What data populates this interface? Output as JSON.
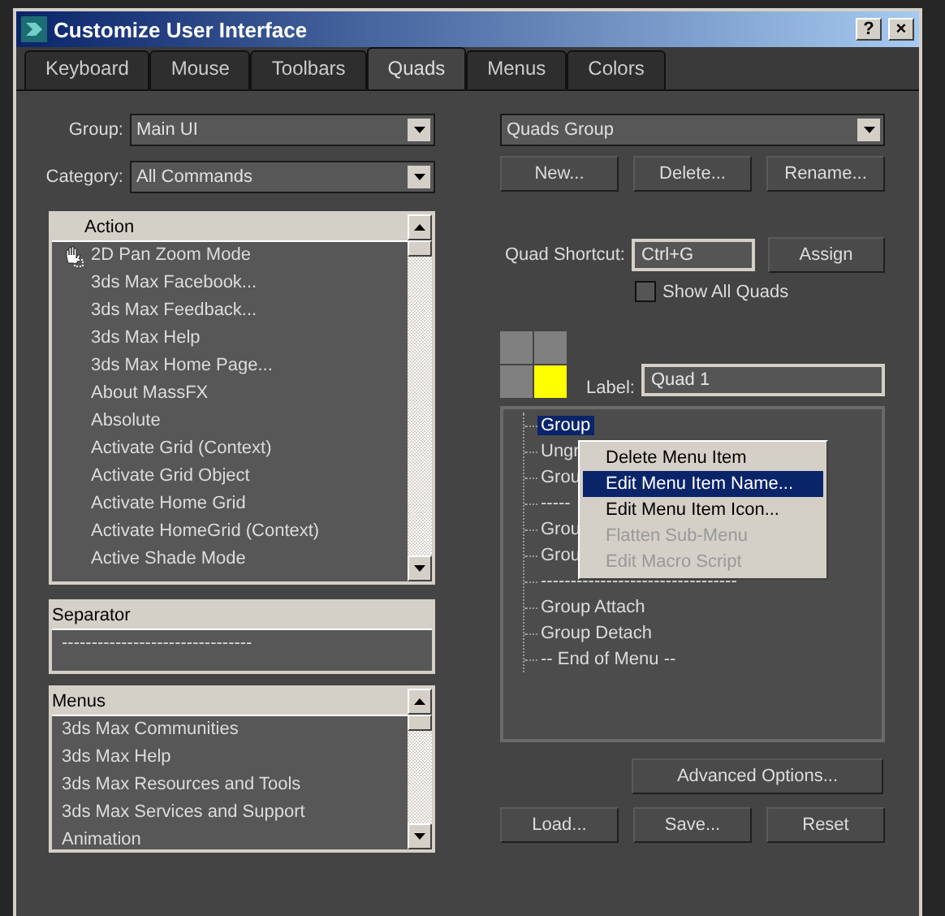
{
  "window": {
    "title": "Customize User Interface",
    "buttons": [
      "?",
      "×"
    ]
  },
  "tabs": [
    {
      "label": "Keyboard",
      "selected": false
    },
    {
      "label": "Mouse",
      "selected": false
    },
    {
      "label": "Toolbars",
      "selected": false
    },
    {
      "label": "Quads",
      "selected": true
    },
    {
      "label": "Menus",
      "selected": false
    },
    {
      "label": "Colors",
      "selected": false
    }
  ],
  "group": {
    "label": "Group:",
    "value": "Main UI"
  },
  "category": {
    "label": "Category:",
    "value": "All Commands"
  },
  "action_list": {
    "header": "Action",
    "rows": [
      {
        "text": "2D Pan Zoom Mode",
        "icon": true
      },
      {
        "text": "3ds Max Facebook...",
        "icon": false
      },
      {
        "text": "3ds Max Feedback...",
        "icon": false
      },
      {
        "text": "3ds Max Help",
        "icon": false
      },
      {
        "text": "3ds Max Home Page...",
        "icon": false
      },
      {
        "text": "About MassFX",
        "icon": false
      },
      {
        "text": "Absolute",
        "icon": false
      },
      {
        "text": "Activate Grid (Context)",
        "icon": false
      },
      {
        "text": "Activate Grid Object",
        "icon": false
      },
      {
        "text": "Activate Home Grid",
        "icon": false
      },
      {
        "text": "Activate HomeGrid (Context)",
        "icon": false
      },
      {
        "text": "Active Shade Mode",
        "icon": false
      }
    ]
  },
  "separator_list": {
    "header": "Separator",
    "rows": [
      "--------------------------------"
    ]
  },
  "menus_list": {
    "header": "Menus",
    "rows": [
      "3ds Max Communities",
      "3ds Max Help",
      "3ds Max Resources and Tools",
      "3ds Max Services and Support",
      "Animation"
    ]
  },
  "quads_group": {
    "value": "Quads Group",
    "buttons": [
      "New...",
      "Delete...",
      "Rename..."
    ]
  },
  "quad_shortcut": {
    "label": "Quad Shortcut:",
    "value": "Ctrl+G",
    "button": "Assign"
  },
  "show_all_quads": {
    "label": "Show All Quads",
    "checked": false
  },
  "quads": [
    {
      "selected": false
    },
    {
      "selected": false
    },
    {
      "selected": false
    },
    {
      "selected": true
    }
  ],
  "quad_label": {
    "label": "Label:",
    "value": "Quad 1"
  },
  "quad_tree": [
    {
      "text": "Group",
      "selected": true
    },
    {
      "text": "Ungr",
      "selected": false
    },
    {
      "text": "Grou",
      "selected": false
    },
    {
      "text": "-----",
      "selected": false
    },
    {
      "text": "Grou",
      "selected": false
    },
    {
      "text": "Grou",
      "selected": false
    },
    {
      "text": "---------------------------------",
      "selected": false
    },
    {
      "text": "Group Attach",
      "selected": false
    },
    {
      "text": "Group Detach",
      "selected": false
    },
    {
      "text": "-- End of Menu --",
      "selected": false
    }
  ],
  "context_menu": [
    {
      "text": "Delete Menu Item",
      "selected": false,
      "disabled": false
    },
    {
      "text": "Edit Menu Item Name...",
      "selected": true,
      "disabled": false
    },
    {
      "text": "Edit Menu Item Icon...",
      "selected": false,
      "disabled": false
    },
    {
      "text": "Flatten Sub-Menu",
      "selected": false,
      "disabled": true
    },
    {
      "text": "Edit Macro Script",
      "selected": false,
      "disabled": true
    }
  ],
  "bottom_buttons": {
    "advanced": "Advanced Options...",
    "actions": [
      "Load...",
      "Save...",
      "Reset"
    ]
  }
}
